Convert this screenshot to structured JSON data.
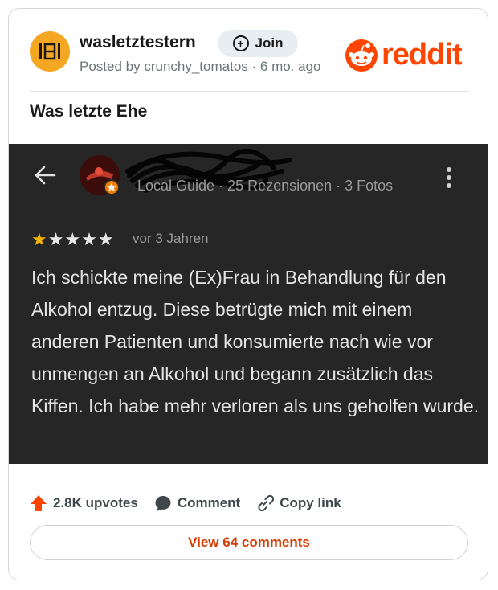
{
  "header": {
    "subreddit": "wasletztestern",
    "join_label": "Join",
    "posted_by": "Posted by crunchy_tomatos · 6 mo. ago",
    "logo_text": "reddit"
  },
  "post": {
    "title": "Was letzte Ehe"
  },
  "review": {
    "meta": "Local Guide · 25 Rezensionen · 3 Fotos",
    "rating": 1,
    "rating_max": 5,
    "stars_filled": "★",
    "stars_empty": "★★★★",
    "time": "vor 3 Jahren",
    "body": "Ich schickte meine (Ex)Frau in Behandlung für den Alkohol entzug. Diese betrügte mich mit einem anderen Patienten und konsumierte nach wie vor unmengen an Alkohol und begann zusätzlich das Kiffen. Ich habe mehr verloren als uns geholfen wurde."
  },
  "actions": {
    "upvotes": "2.8K upvotes",
    "comment": "Comment",
    "copy_link": "Copy link",
    "view_comments": "View 64 comments"
  },
  "colors": {
    "accent": "#ff4500",
    "subreddit_icon": "#f5a623",
    "dark_panel": "#262626",
    "star": "#f4b400"
  }
}
